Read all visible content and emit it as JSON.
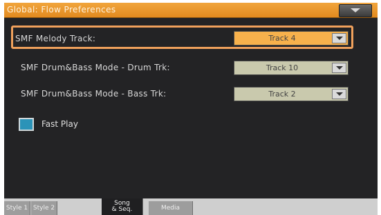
{
  "window": {
    "title": "Global: Flow Preferences"
  },
  "settings": {
    "smf_melody_track": {
      "label": "SMF Melody Track:",
      "value": "Track 4"
    },
    "smf_drum_trk": {
      "label": "SMF Drum&Bass Mode - Drum Trk:",
      "value": "Track 10"
    },
    "smf_bass_trk": {
      "label": "SMF Drum&Bass Mode - Bass Trk:",
      "value": "Track 2"
    },
    "fast_play": {
      "label": "Fast Play",
      "checked": true
    }
  },
  "tabs": [
    {
      "label": "Style 1"
    },
    {
      "label": "Style 2"
    },
    {
      "label_line1": "Song",
      "label_line2": "& Seq.",
      "selected": true
    },
    {
      "label": "Media"
    }
  ],
  "colors": {
    "title_bar": "#e8951f",
    "highlight_outline": "#f0a15c",
    "active_dropdown": "#f7b14c",
    "inactive_dropdown": "#c9c9ad",
    "checkbox_fill": "#2b93b8"
  },
  "icons": {
    "menu": "chevron-down-icon",
    "dropdown": "chevron-down-icon",
    "checkbox": "checkbox-icon"
  }
}
